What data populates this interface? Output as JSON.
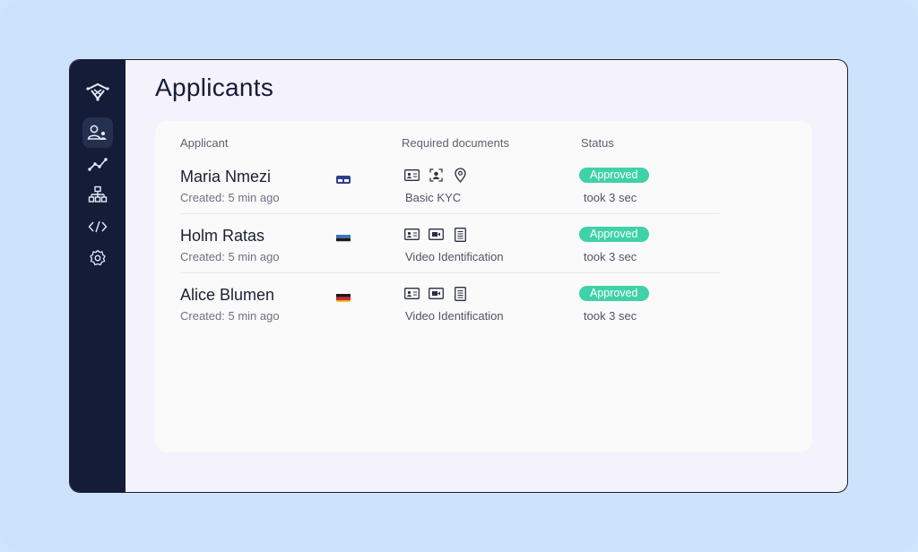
{
  "page": {
    "title": "Applicants"
  },
  "table": {
    "headers": {
      "applicant": "Applicant",
      "documents": "Required documents",
      "status": "Status"
    },
    "rows": [
      {
        "name": "Maria Nmezi",
        "created": "Created: 5 min ago",
        "flag": "eu-card",
        "docs": [
          "id-card-icon",
          "face-scan-icon",
          "location-pin-icon"
        ],
        "doc_type": "Basic KYC",
        "status": "Approved",
        "time": "took 3 sec"
      },
      {
        "name": "Holm Ratas",
        "created": "Created: 5 min ago",
        "flag": "estonia",
        "docs": [
          "id-card-icon",
          "video-icon",
          "document-icon"
        ],
        "doc_type": "Video Identification",
        "status": "Approved",
        "time": "took 3 sec"
      },
      {
        "name": "Alice Blumen",
        "created": "Created: 5 min ago",
        "flag": "germany",
        "docs": [
          "id-card-icon",
          "video-icon",
          "document-icon"
        ],
        "doc_type": "Video Identification",
        "status": "Approved",
        "time": "took 3 sec"
      }
    ]
  },
  "sidebar": {
    "items": [
      "logo-icon",
      "applicants-icon",
      "analytics-icon",
      "hierarchy-icon",
      "code-icon",
      "settings-icon"
    ]
  },
  "colors": {
    "sidebar": "#141c38",
    "approved": "#3fd1a8",
    "background": "#cfe5fb"
  }
}
